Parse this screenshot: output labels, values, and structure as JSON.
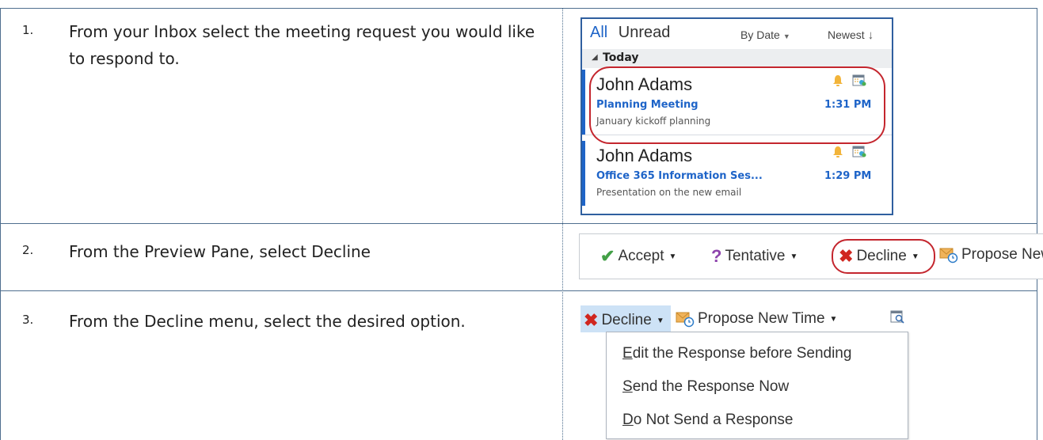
{
  "steps": [
    {
      "num": "1.",
      "text": "From your Inbox select the meeting request you would like to respond to."
    },
    {
      "num": "2.",
      "text": "From the Preview Pane, select Decline"
    },
    {
      "num": "3.",
      "text": "From the Decline menu, select the desired option."
    }
  ],
  "inbox": {
    "tab_all": "All",
    "tab_unread": "Unread",
    "sort_by": "By Date",
    "sort_order": "Newest",
    "group_label": "Today",
    "messages": [
      {
        "sender": "John Adams",
        "subject": "Planning Meeting",
        "time": "1:31 PM",
        "preview": "January kickoff planning"
      },
      {
        "sender": "John Adams",
        "subject": "Office 365 Information Ses...",
        "time": "1:29 PM",
        "preview": "Presentation on the new email"
      }
    ],
    "accent_color": "#1e64c8"
  },
  "toolbar": {
    "accept": "Accept",
    "tentative": "Tentative",
    "decline": "Decline",
    "propose": "Propose New"
  },
  "decline_menu": {
    "decline": "Decline",
    "propose": "Propose New Time",
    "options": [
      {
        "hotkey": "E",
        "rest": "dit the Response before Sending"
      },
      {
        "hotkey": "S",
        "rest": "end the Response Now"
      },
      {
        "hotkey": "D",
        "rest": "o Not Send a Response"
      }
    ]
  },
  "colors": {
    "highlight": "#c4262e",
    "border": "#4f6f8f"
  }
}
